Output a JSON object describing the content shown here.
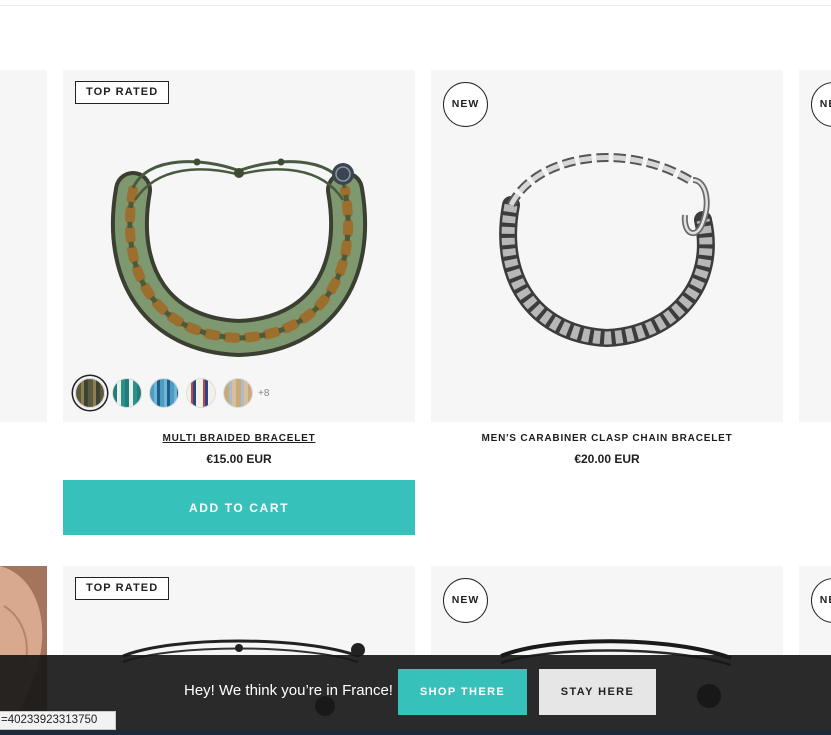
{
  "colors": {
    "accent": "#36c2bb",
    "card_bg": "#f6f6f6",
    "text": "#1e1e1e",
    "banner_bg": "#181818"
  },
  "products": [
    {
      "badge": "TOP RATED",
      "name": "MULTI BRAIDED BRACELET",
      "price": "€15.00 EUR",
      "swatch_colors": [
        "#6b6648",
        "#2c8f8c",
        "#4e9cc2",
        "#c7433c",
        "#c9a97e"
      ],
      "more_swatches": "+8",
      "add_to_cart": "ADD TO CART"
    },
    {
      "badge": "NEW",
      "name": "MEN'S CARABINER CLASP CHAIN BRACELET",
      "price": "€20.00 EUR"
    },
    {
      "badge": "NEW"
    }
  ],
  "row2": [
    {
      "badge": "TOP RATED"
    },
    {
      "badge": "NEW"
    },
    {
      "badge": "NEW"
    }
  ],
  "geo_banner": {
    "message": "Hey! We think you’re in France!",
    "shop_there": "SHOP THERE",
    "stay_here": "STAY HERE"
  },
  "status_url": "=40233923313750"
}
